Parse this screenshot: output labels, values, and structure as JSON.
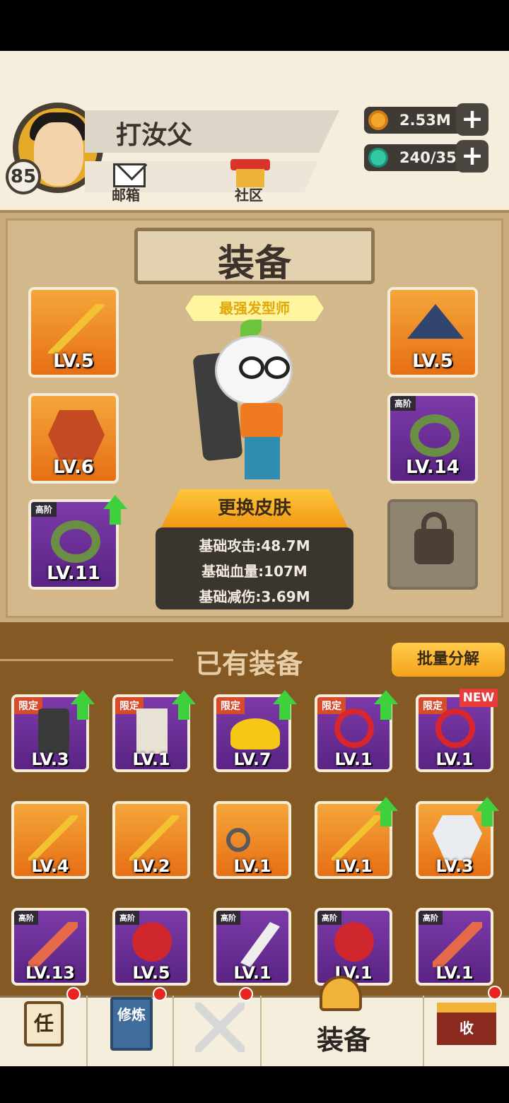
{
  "player": {
    "name": "打汝父",
    "level": "85"
  },
  "header_links": {
    "mail": "邮箱",
    "community": "社区"
  },
  "resources": {
    "coins": "2.53M",
    "energy": "240/35"
  },
  "equip": {
    "title": "装备",
    "character_title": "最强发型师",
    "change_skin": "更换皮肤",
    "stats": [
      "基础攻击:48.7M",
      "基础血量:107M",
      "基础减伤:3.69M"
    ],
    "slots": [
      {
        "lv": "LV.5",
        "tag": ""
      },
      {
        "lv": "LV.6",
        "tag": ""
      },
      {
        "lv": "LV.11",
        "tag": "高阶"
      },
      {
        "lv": "LV.5",
        "tag": ""
      },
      {
        "lv": "LV.14",
        "tag": "高阶"
      }
    ]
  },
  "owned": {
    "title": "已有装备",
    "batch": "批量分解",
    "new_label": "NEW",
    "row1": [
      {
        "lv": "LV.3",
        "tag": "限定"
      },
      {
        "lv": "LV.1",
        "tag": "限定"
      },
      {
        "lv": "LV.7",
        "tag": "限定"
      },
      {
        "lv": "LV.1",
        "tag": "限定"
      },
      {
        "lv": "LV.1",
        "tag": "限定"
      }
    ],
    "row2": [
      {
        "lv": "LV.4"
      },
      {
        "lv": "LV.2"
      },
      {
        "lv": "LV.1"
      },
      {
        "lv": "LV.1"
      },
      {
        "lv": "LV.3"
      }
    ],
    "row3": [
      {
        "lv": "LV.13",
        "tag": "高阶"
      },
      {
        "lv": "LV.5",
        "tag": "高阶"
      },
      {
        "lv": "LV.1",
        "tag": "高阶"
      },
      {
        "lv": "LV.1",
        "tag": "高阶"
      },
      {
        "lv": "LV.1",
        "tag": "高阶"
      }
    ]
  },
  "nav": {
    "task_glyph": "任",
    "cultivate_glyph": "修炼",
    "equip_label": "装备",
    "collect_glyph": "收"
  }
}
